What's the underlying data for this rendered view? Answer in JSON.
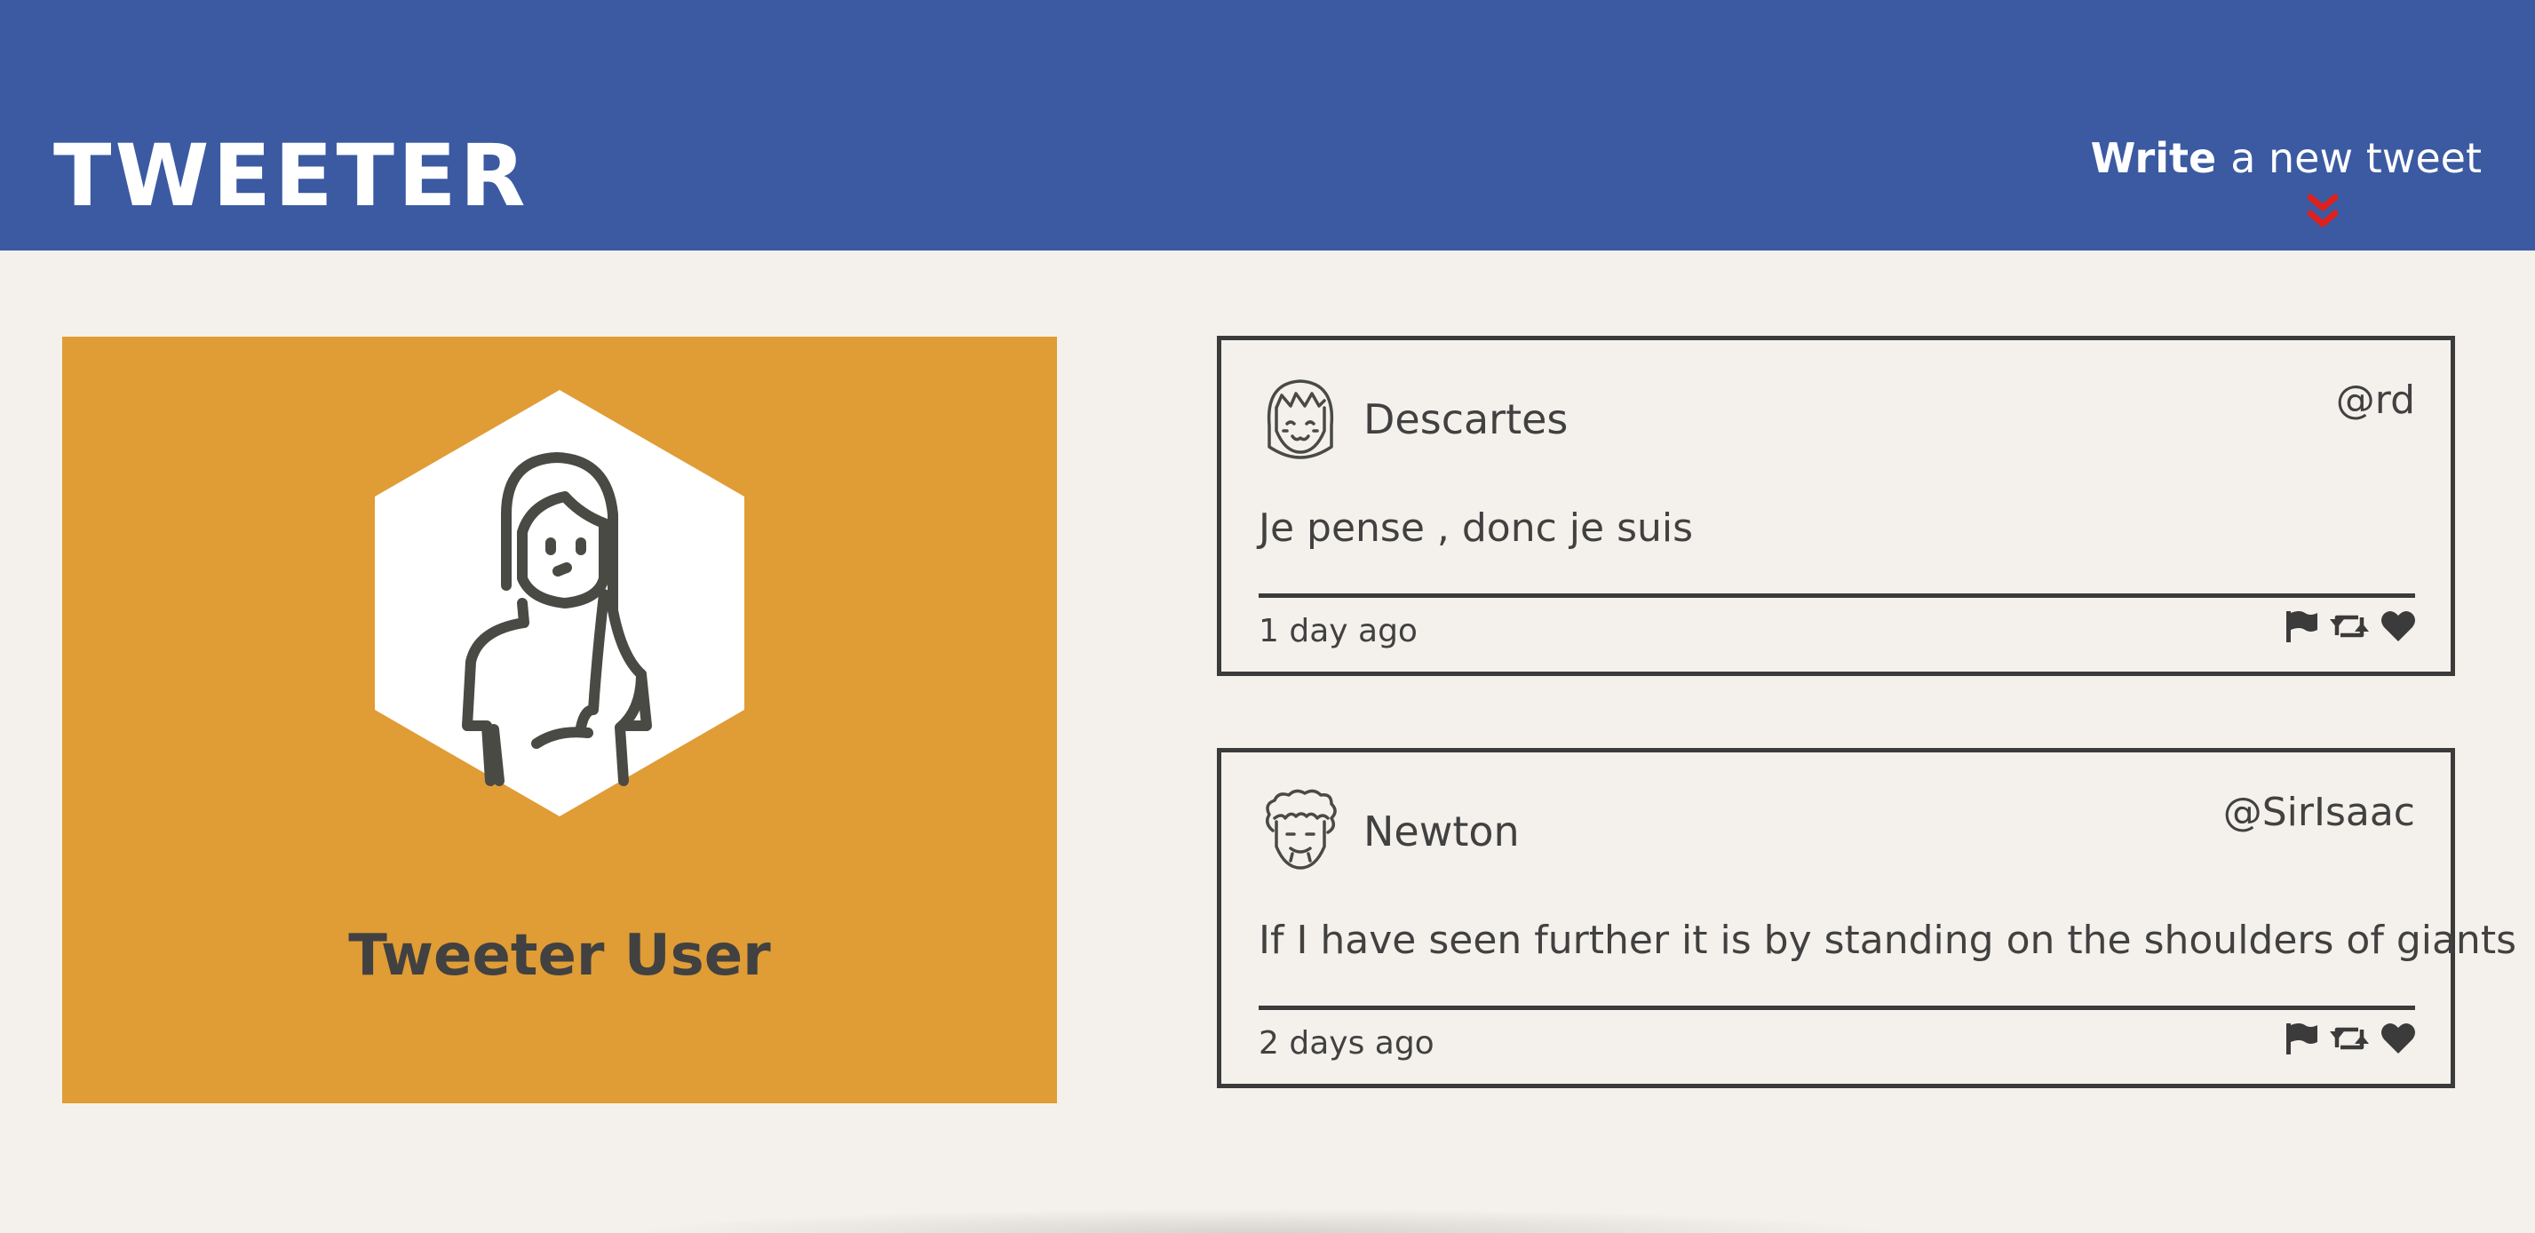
{
  "nav": {
    "logo": "TWEETER",
    "compose_bold": "Write",
    "compose_rest": "a new tweet"
  },
  "colors": {
    "nav_bg": "#3b5aa2",
    "page_bg": "#f4f1ec",
    "profile_bg": "#e09c35",
    "text": "#414141",
    "chevron": "#e0201c"
  },
  "profile": {
    "name": "Tweeter User",
    "avatar_icon": "female-user-avatar-icon"
  },
  "tweets": [
    {
      "name": "Descartes",
      "handle": "@rd",
      "content": "Je pense , donc je suis",
      "time": "1 day ago",
      "avatar_icon": "girl-avatar-icon"
    },
    {
      "name": "Newton",
      "handle": "@SirIsaac",
      "content": "If I have seen further it is by standing on the shoulders of giants",
      "time": "2 days ago",
      "avatar_icon": "curly-hair-avatar-icon"
    }
  ],
  "actions": [
    "flag-icon",
    "retweet-icon",
    "heart-icon"
  ]
}
